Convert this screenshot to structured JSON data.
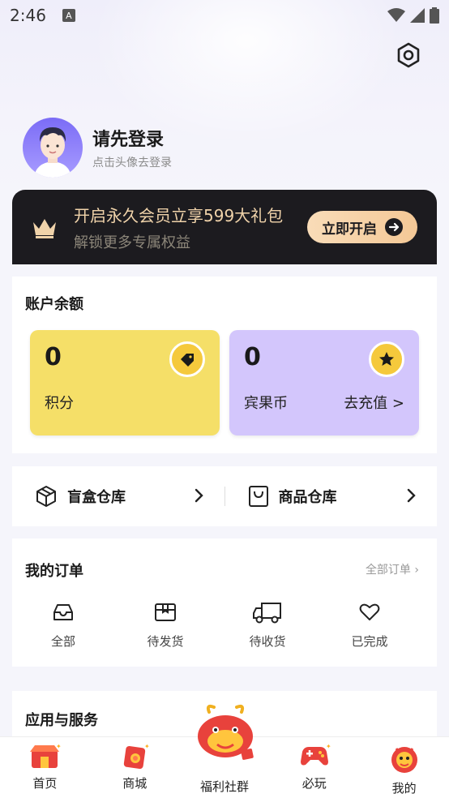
{
  "status_bar": {
    "time": "2:46"
  },
  "profile": {
    "title": "请先登录",
    "subtitle": "点击头像去登录"
  },
  "vip": {
    "title": "开启永久会员立享599大礼包",
    "subtitle": "解锁更多专属权益",
    "button": "立即开启"
  },
  "balance": {
    "title": "账户余额",
    "points": {
      "value": "0",
      "label": "积分"
    },
    "coins": {
      "value": "0",
      "label": "宾果币",
      "link": "去充值 >"
    }
  },
  "warehouse": {
    "blind_box": "盲盒仓库",
    "goods": "商品仓库"
  },
  "orders": {
    "title": "我的订单",
    "all": "全部订单 ›",
    "tabs": [
      "全部",
      "待发货",
      "待收货",
      "已完成"
    ]
  },
  "services": {
    "title": "应用与服务"
  },
  "nav": {
    "items": [
      "首页",
      "商城",
      "福利社群",
      "必玩",
      "我的"
    ]
  },
  "colors": {
    "points_bg": "#f5df68",
    "coins_bg": "#d3c6fc",
    "vip_bg": "#1c1b1f",
    "vip_gold": "#f0d3aa"
  }
}
